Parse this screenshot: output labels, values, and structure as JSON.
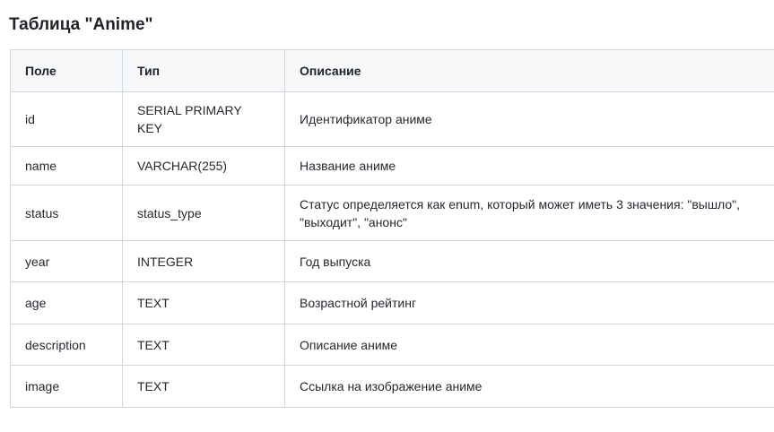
{
  "title": "Таблица \"Anime\"",
  "table": {
    "headers": [
      "Поле",
      "Тип",
      "Описание"
    ],
    "rows": [
      {
        "field": "id",
        "type": "SERIAL PRIMARY KEY",
        "description": "Идентификатор аниме"
      },
      {
        "field": "name",
        "type": "VARCHAR(255)",
        "description": "Название аниме"
      },
      {
        "field": "status",
        "type": "status_type",
        "description": "Статус определяется как enum, который может иметь 3 значения: \"вышло\", \"выходит\", \"анонс\""
      },
      {
        "field": "year",
        "type": "INTEGER",
        "description": "Год выпуска"
      },
      {
        "field": "age",
        "type": "TEXT",
        "description": "Возрастной рейтинг"
      },
      {
        "field": "description",
        "type": "TEXT",
        "description": "Описание аниме"
      },
      {
        "field": "image",
        "type": "TEXT",
        "description": "Ссылка на изображение аниме"
      }
    ]
  }
}
